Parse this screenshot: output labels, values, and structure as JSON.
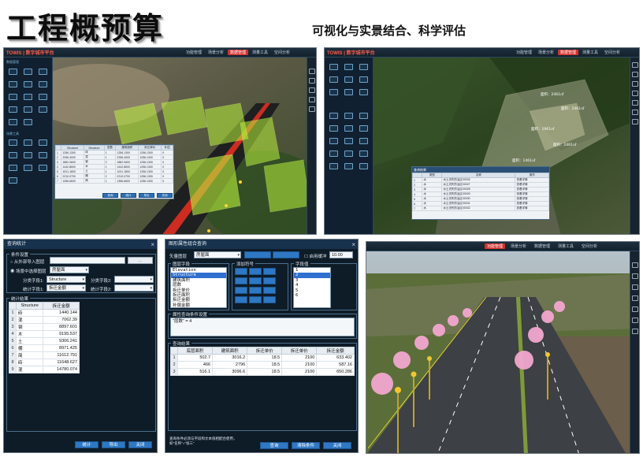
{
  "title": "工程概预算",
  "subtitle": "可视化与实景结合、科学评估",
  "panels": {
    "top_left": {
      "brand": "TOWIS | 数字城市平台",
      "menu": [
        "功能管理",
        "场景分析",
        "数据管理",
        "测量工具",
        "空间分析"
      ],
      "active_menu": 2,
      "sidebar_sections": [
        "数据管理",
        "场景工具"
      ],
      "table": {
        "headers": [
          "",
          "Structure",
          "Structure",
          "层数",
          "建筑面积",
          "拆迁单价",
          "补偿"
        ],
        "rows": [
          [
            "1",
            "1256.1300",
            "砖",
            "1",
            "1256.1300",
            "1256.1300",
            "0"
          ],
          [
            "2",
            "2256.4000",
            "混",
            "1",
            "2256.4000",
            "1256.1300",
            "0"
          ],
          [
            "3",
            "1882.0600",
            "钢",
            "2",
            "1882.0600",
            "1256.1300",
            "0"
          ],
          [
            "4",
            "1442.8600",
            "木",
            "1",
            "1442.8600",
            "1256.1300",
            "0"
          ],
          [
            "5",
            "1021.1800",
            "土",
            "1",
            "1021.1800",
            "1256.1300",
            "0"
          ],
          [
            "6",
            "2210.0700",
            "棚",
            "2",
            "2210.0700",
            "1256.1300",
            "0"
          ],
          [
            "7",
            "1356.6600",
            "简",
            "1",
            "1356.6600",
            "1256.1300",
            "0"
          ]
        ],
        "buttons": [
          "查询",
          "统计",
          "导出",
          "关闭"
        ]
      }
    },
    "top_right": {
      "brand": "TOWIS | 数字城市平台",
      "menu": [
        "功能管理",
        "场景分析",
        "数据管理",
        "测量工具",
        "空间分析"
      ],
      "active_menu": 2,
      "scene_labels": [
        "面积：2461㎡",
        "面积：2461㎡",
        "面积：1961㎡",
        "面积：2461㎡",
        "面积：1461㎡"
      ],
      "table_title": "查询结果",
      "table": {
        "headers": [
          "",
          "类型",
          "名称",
          "操作"
        ],
        "rows": [
          [
            "1",
            "水",
            "水土流失防治区00026",
            "查看详情"
          ],
          [
            "2",
            "水",
            "水土流失防治区00027",
            "查看详情"
          ],
          [
            "3",
            "水",
            "水土流失防治区00028",
            "查看详情"
          ],
          [
            "4",
            "水",
            "水土流失防治区00029",
            "查看详情"
          ],
          [
            "5",
            "水",
            "水土流失防治区00030",
            "查看详情"
          ],
          [
            "6",
            "水",
            "水土流失防治区00031",
            "查看详情"
          ],
          [
            "7",
            "水",
            "水土流失防治区00032",
            "查看详情"
          ]
        ]
      }
    },
    "bottom_left": {
      "dialog_title": "查询统计",
      "condition_group": "条件设置",
      "option_file": "从外部导入图层",
      "option_scene": "场景中选择图层",
      "scene_layer_value": "房屋面",
      "group_field_label": "分类字段1:",
      "group_field_value": "Structure",
      "group_field2_label": "分类字段2:",
      "stat_field_label": "统计字段1:",
      "stat_field_value": "拆迁金额",
      "stat_field2_label": "统计字段2:",
      "result_group": "统计结果",
      "result_headers": [
        "Structure",
        "拆迁金额"
      ],
      "result_rows": [
        [
          "1",
          "砖",
          "1440.144"
        ],
        [
          "2",
          "混",
          "7062.39"
        ],
        [
          "3",
          "钢",
          "8897.601"
        ],
        [
          "4",
          "木",
          "9195.537"
        ],
        [
          "5",
          "土",
          "9306.241"
        ],
        [
          "6",
          "棚",
          "8971.425"
        ],
        [
          "7",
          "简",
          "11612.791"
        ],
        [
          "8",
          "砖",
          "11648.627"
        ],
        [
          "9",
          "混",
          "14780.074"
        ]
      ],
      "buttons": [
        "统计",
        "导出",
        "关闭"
      ]
    },
    "bottom_mid": {
      "dialog_title": "图形属性组合查询",
      "layer_label": "矢量图层",
      "layer_value": "房屋面",
      "apply_label": "启用缓冲",
      "buffer_value": "10.00",
      "field_group": "图层字段",
      "fields": [
        "Elevation",
        "Structure",
        "建筑面积",
        "层数",
        "拆迁单价",
        "拆迁面积",
        "拆迁金额",
        "补偿金额"
      ],
      "selected_field_index": 1,
      "operator_group": "添加符号",
      "value_group": "字段值",
      "values": [
        "1",
        "2",
        "3",
        "4",
        "5",
        "6"
      ],
      "selected_value_index": 1,
      "condition_group": "属性查询条件设置",
      "condition_text": "\"层数\" = 4",
      "result_group": "查询结果",
      "result_headers": [
        "底层面积",
        "建筑面积",
        "拆迁单价",
        "拆迁单价",
        "拆迁金额"
      ],
      "result_rows": [
        [
          "1",
          "502.7",
          "3016.2",
          "18.5",
          "2100",
          "633.402"
        ],
        [
          "2",
          "466",
          "2796",
          "18.5",
          "2100",
          "587.16"
        ],
        [
          "3",
          "516.1",
          "3096.6",
          "18.5",
          "2100",
          "650.286"
        ]
      ],
      "footer_note": "查询条件必须与字段和文本值相配合使用，如\"名称\"=\"张三\"",
      "buttons": [
        "查询",
        "清除条件",
        "关闭"
      ]
    },
    "bottom_right": {
      "menu": [
        "功能管理",
        "场景分析",
        "数据管理",
        "测量工具",
        "空间分析"
      ],
      "active_menu": 0
    }
  }
}
